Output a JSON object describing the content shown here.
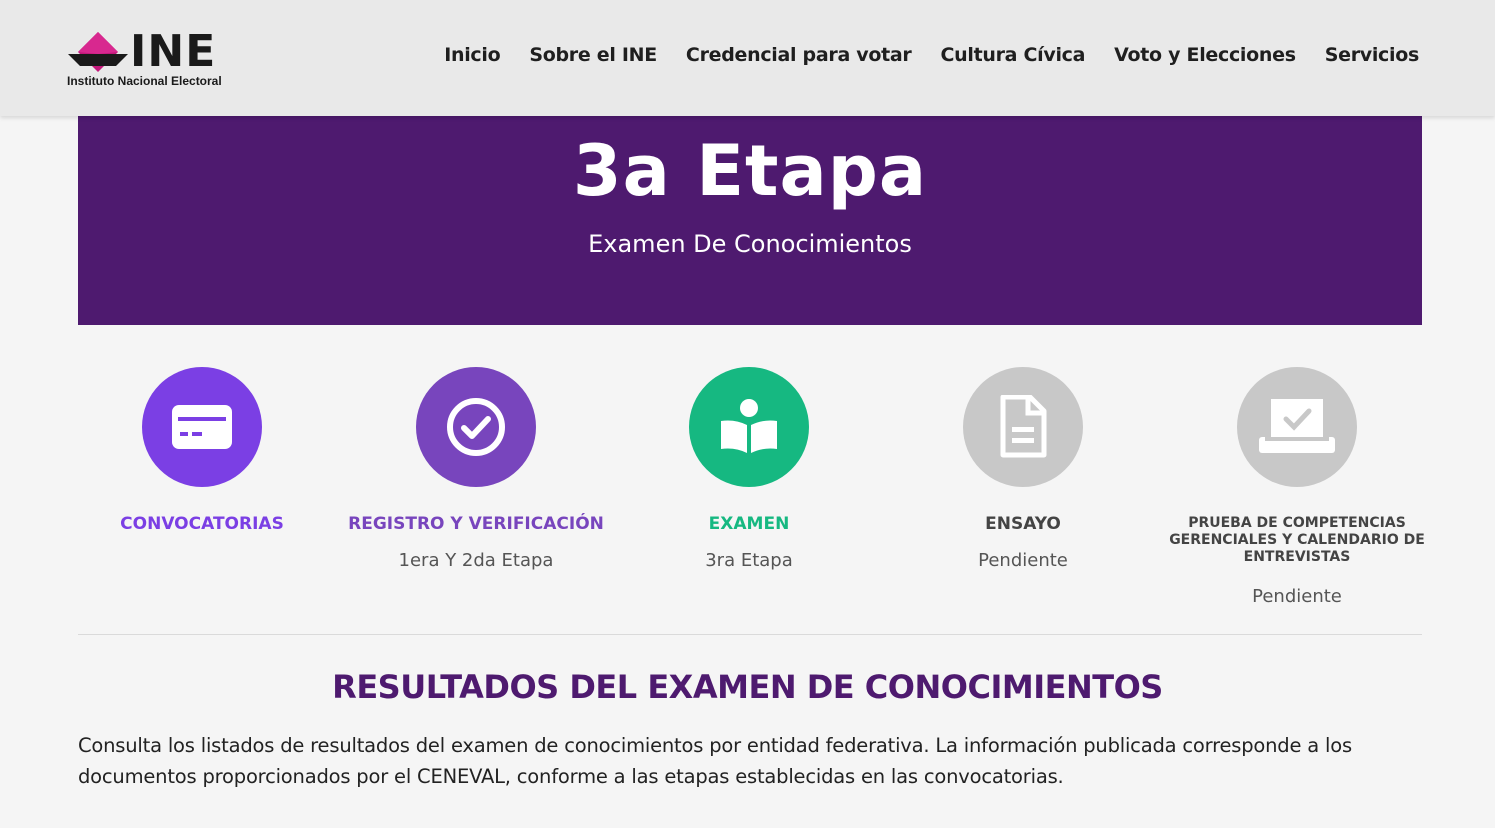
{
  "header": {
    "logo_word": "INE",
    "logo_subtitle": "Instituto Nacional Electoral",
    "nav": [
      "Inicio",
      "Sobre el INE",
      "Credencial para votar",
      "Cultura Cívica",
      "Voto y Elecciones",
      "Servicios"
    ]
  },
  "banner": {
    "title": "3a Etapa",
    "subtitle": "Examen De Conocimientos"
  },
  "steps": [
    {
      "label": "CONVOCATORIAS",
      "sub": "",
      "icon": "ticket-icon",
      "color": "#7b3fe4",
      "label_color": "#7b3fe4"
    },
    {
      "label": "REGISTRO Y VERIFICACIÓN",
      "sub": "1era Y 2da Etapa",
      "icon": "check-circle-icon",
      "color": "#7845bd",
      "label_color": "#7845bd"
    },
    {
      "label": "EXAMEN",
      "sub": "3ra Etapa",
      "icon": "reader-book-icon",
      "color": "#16b881",
      "label_color": "#16b881"
    },
    {
      "label": "ENSAYO",
      "sub": "Pendiente",
      "icon": "document-icon",
      "color": "#c8c8c8",
      "label_color": "#444444"
    },
    {
      "label": "PRUEBA DE COMPETENCIAS GERENCIALES Y CALENDARIO DE ENTREVISTAS",
      "sub": "Pendiente",
      "icon": "ballot-box-icon",
      "color": "#c8c8c8",
      "label_color": "#444444"
    }
  ],
  "results": {
    "title": "RESULTADOS DEL EXAMEN DE CONOCIMIENTOS",
    "text": "Consulta los listados de resultados del examen de conocimientos por entidad federativa. La información publicada corresponde a los documentos proporcionados por el CENEVAL, conforme a las etapas establecidas en las convocatorias."
  },
  "colors": {
    "brand_purple": "#4e1a6f",
    "logo_magenta": "#c2187a",
    "header_bg": "#e9e9e9"
  }
}
